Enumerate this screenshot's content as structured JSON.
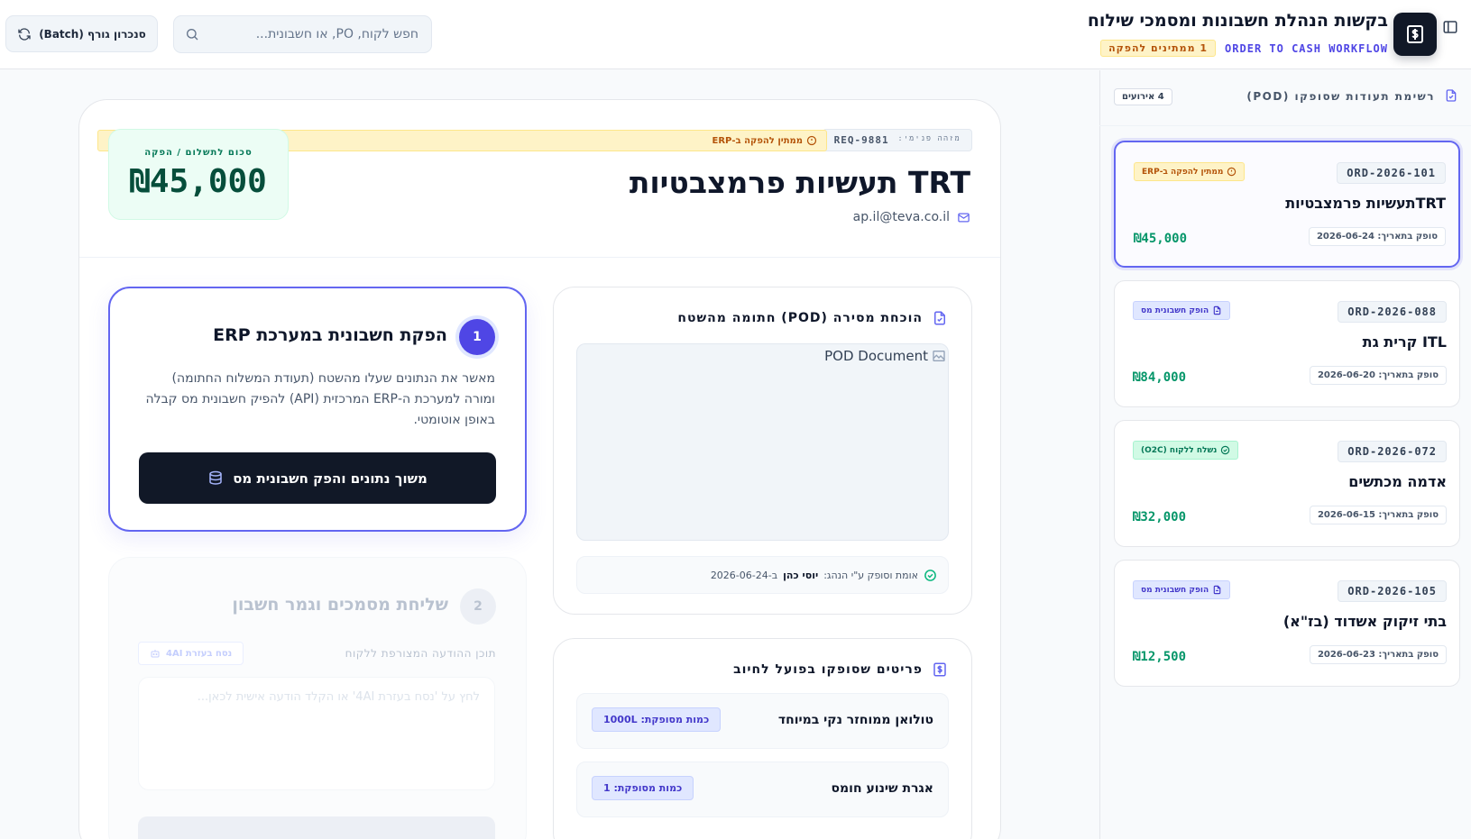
{
  "header": {
    "title": "בקשות הנהלת חשבונות ומסמכי שילוח",
    "workflow_label": "ORDER TO CASH WORKFLOW",
    "pending_pill": "1 ממתינים להפקה",
    "search_placeholder": "חפש לקוח, PO, או חשבונית...",
    "sync_button": "סנכרון גורף (Batch)"
  },
  "sidebar": {
    "title": "רשימת תעודות שסופקו (POD)",
    "events_badge": "4 אירועים",
    "orders": [
      {
        "id": "ORD-2026-101",
        "name": "TRTתעשיות פרמצבטיות",
        "date": "סופק בתאריך: 2026-06-24",
        "amount": "₪45,000",
        "status": "ממתין להפקה ב-ERP",
        "status_icon": "alert-circle-icon",
        "active": true
      },
      {
        "id": "ORD-2026-088",
        "name": "ITL קרית גת",
        "date": "סופק בתאריך: 2026-06-20",
        "amount": "₪84,000",
        "status": "הופק חשבונית מס",
        "status_icon": "invoice-icon",
        "active": false
      },
      {
        "id": "ORD-2026-072",
        "name": "אדמה מכתשים",
        "date": "סופק בתאריך: 2026-06-15",
        "amount": "₪32,000",
        "status": "נשלח ללקוח (O2C)",
        "status_icon": "check-circle-icon",
        "active": false
      },
      {
        "id": "ORD-2026-105",
        "name": "בתי זיקוק אשדוד (בז\"א)",
        "date": "סופק בתאריך: 2026-06-23",
        "amount": "₪12,500",
        "status": "הופק חשבונית מס",
        "status_icon": "invoice-icon",
        "active": false
      }
    ]
  },
  "detail": {
    "req_label": "מזהה פנימי:",
    "req_id": "REQ-9881",
    "status": "ממתין להפקה ב-ERP",
    "customer": "TRT תעשיות פרמצבטיות",
    "email": "ap.il@teva.co.il",
    "amount_label": "סכום לתשלום / הפקה",
    "amount": "₪45,000"
  },
  "step1": {
    "number": "1",
    "title": "הפקת חשבונית במערכת ERP",
    "description": "מאשר את הנתונים שעלו מהשטח (תעודת המשלוח החתומה) ומורה למערכת ה-ERP המרכזית (API) להפיק חשבונית מס קבלה באופן אוטומטי.",
    "button": "משוך נתונים והפק חשבונית מס"
  },
  "step2": {
    "number": "2",
    "title": "שליחת מסמכים וגמר חשבון",
    "message_label": "תוכן ההודעה המצורפת ללקוח",
    "ai_button": "נסח בעזרת 4AI",
    "placeholder": "לחץ על 'נסח בעזרת 4AI' או הקלד הודעה אישית לכאן..."
  },
  "pod": {
    "title": "הוכחת מסירה (POD) חתומה מהשטח",
    "image_alt": "POD Document",
    "signed_label": "אומת וסופק ע\"י הנהג:",
    "driver": "יוסי כהן",
    "signed_date": "ב-2026-06-24"
  },
  "items": {
    "title": "פריטים שסופקו בפועל לחיוב",
    "list": [
      {
        "name": "טולואן ממוחזר נקי במיוחד",
        "qty": "כמות מסופקת: 1000L"
      },
      {
        "name": "אגרת שינוע חומס",
        "qty": "כמות מסופקת: 1"
      }
    ]
  },
  "colors": {
    "accent": "#4f46e5",
    "dark": "#111827",
    "money_green": "#059669",
    "pending_amber": "#b45309"
  }
}
